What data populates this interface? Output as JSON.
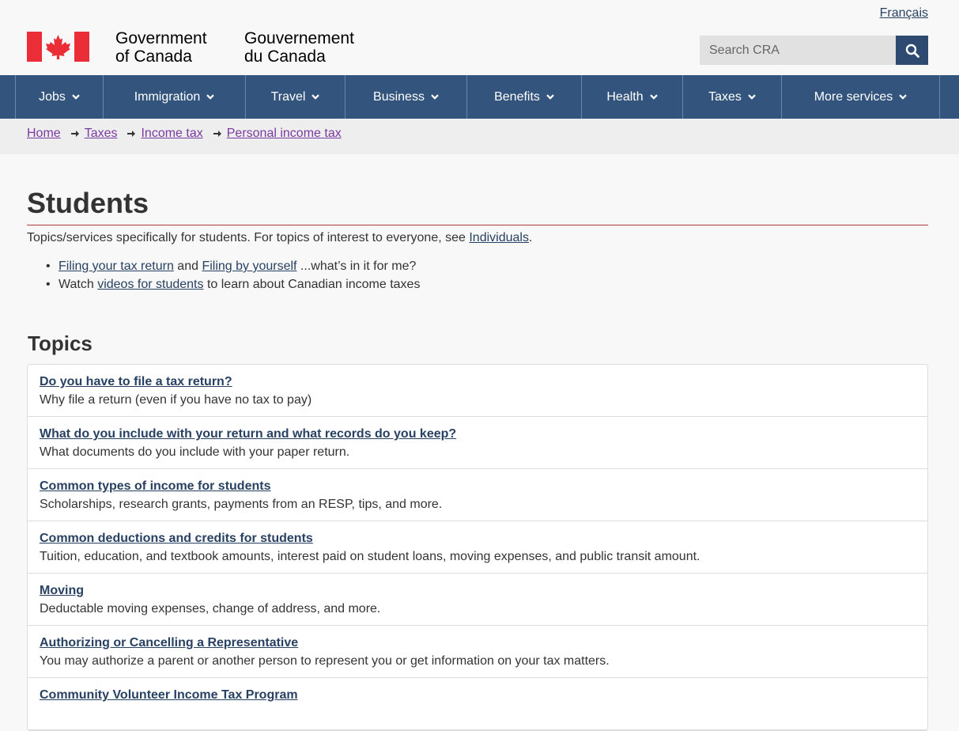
{
  "header": {
    "signature_en_line1": "Government",
    "signature_en_line2": "of Canada",
    "signature_fr_line1": "Gouvernement",
    "signature_fr_line2": "du Canada",
    "language_link": "Français",
    "search_placeholder": "Search CRA",
    "colors": {
      "flag_red": "#eb2d37",
      "nav_bg": "#33557d",
      "search_btn": "#2e4a70"
    }
  },
  "nav": {
    "items": [
      {
        "label": "Jobs"
      },
      {
        "label": "Immigration"
      },
      {
        "label": "Travel"
      },
      {
        "label": "Business"
      },
      {
        "label": "Benefits"
      },
      {
        "label": "Health"
      },
      {
        "label": "Taxes"
      },
      {
        "label": "More services"
      }
    ]
  },
  "breadcrumb": [
    "Home",
    "Taxes",
    "Income tax",
    "Personal income tax"
  ],
  "page": {
    "title": "Students",
    "intro_text": "Topics/services specifically for students. For topics of interest to everyone, see ",
    "intro_link": "Individuals",
    "intro_end": ".",
    "bullet1_link1": "Filing your tax return",
    "bullet1_and": " and ",
    "bullet1_link2": "Filing by yourself",
    "bullet1_rest": " ...what’s in it for me?",
    "bullet2_pre": "Watch ",
    "bullet2_link": "videos for students",
    "bullet2_rest": " to learn about Canadian income taxes",
    "topics_heading": "Topics"
  },
  "topics": [
    {
      "title": "Do you have to file a tax return?",
      "desc": "Why file a return (even if you have no tax to pay)"
    },
    {
      "title": "What do you include with your return and what records do you keep?",
      "desc": "What documents do you include with your paper return."
    },
    {
      "title": "Common types of income for students",
      "desc": "Scholarships, research grants, payments from an RESP, tips, and more."
    },
    {
      "title": "Common deductions and credits for students",
      "desc": "Tuition, education, and textbook amounts, interest paid on student loans, moving expenses, and public transit amount."
    },
    {
      "title": "Moving",
      "desc": "Deductable moving expenses, change of address, and more."
    },
    {
      "title": "Authorizing or Cancelling a Representative",
      "desc": "You may authorize a parent or another person to represent you or get information on your tax matters."
    },
    {
      "title": "Community Volunteer Income Tax Program",
      "desc": ""
    }
  ]
}
